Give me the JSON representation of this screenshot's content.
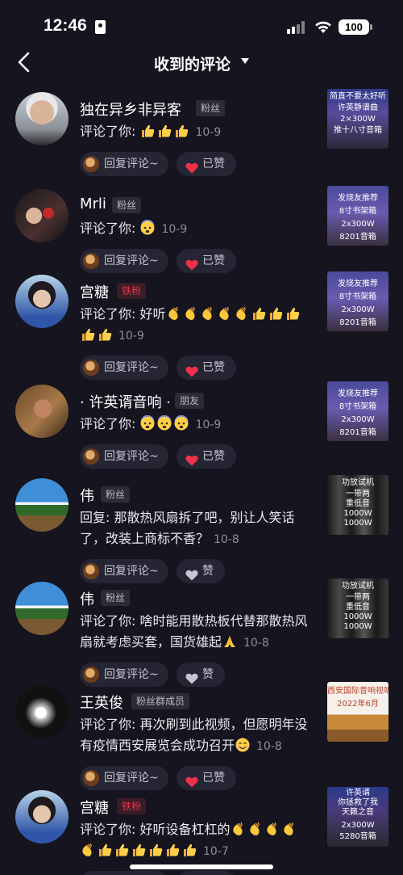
{
  "status": {
    "time": "12:46",
    "battery": "100"
  },
  "nav": {
    "title": "收到的评论"
  },
  "actions": {
    "reply_label": "回复评论~",
    "liked_label": "已赞",
    "like_label": "赞"
  },
  "colors": {
    "background": "#15141f",
    "liked_heart": "#f0314a",
    "unliked_heart": "#c7c6d0",
    "button_bg": "#262534"
  },
  "comments": [
    {
      "username": "独在异乡非异客",
      "badge": "粉丝",
      "badge_style": "normal",
      "prefix": "评论了你: ",
      "text": "",
      "emojis": [
        "thumbs-up",
        "thumbs-up",
        "thumbs-up"
      ],
      "date": "10-9",
      "liked": true,
      "thumb": {
        "lines": [
          "简直不要太好听",
          "许英静谱曲",
          "2×300W",
          "推十八寸音箱"
        ]
      }
    },
    {
      "username": "Mrli",
      "badge": "粉丝",
      "badge_style": "normal",
      "prefix": "评论了你: ",
      "text": "",
      "emojis": [
        "fearful-face"
      ],
      "date": "10-9",
      "liked": true,
      "thumb": {
        "lines": [
          "发烧友推荐",
          "8寸书架箱",
          "2x300W",
          "8201音箱"
        ]
      }
    },
    {
      "username": "宫糖",
      "badge": "铁粉",
      "badge_style": "gold",
      "prefix": "评论了你: ",
      "text": "好听",
      "emojis": [
        "clap",
        "clap",
        "clap",
        "clap",
        "clap",
        "thumbs-up",
        "thumbs-up",
        "thumbs-up",
        "thumbs-up",
        "thumbs-up"
      ],
      "date": "10-9",
      "liked": true,
      "thumb": {
        "lines": [
          "发烧友推荐",
          "8寸书架箱",
          "2x300W",
          "8201音箱"
        ]
      }
    },
    {
      "username": "· 许英谞音响 ·",
      "badge": "朋友",
      "badge_style": "normal",
      "prefix": "评论了你: ",
      "text": "",
      "emojis": [
        "fearful-face",
        "fearful-face",
        "fearful-face"
      ],
      "date": "10-9",
      "liked": true,
      "thumb": {
        "lines": [
          "发烧友推荐",
          "8寸书架箱",
          "2x300W",
          "8201音箱"
        ]
      }
    },
    {
      "username": "伟",
      "badge": "粉丝",
      "badge_style": "normal",
      "prefix": "回复: ",
      "text": "那散热风扇拆了吧，别让人笑话了，改装上商标不香？",
      "emojis": [],
      "date": "10-8",
      "liked": false,
      "thumb": {
        "lines": [
          "功放试机",
          "一带两",
          "重低音",
          "1000W",
          "1000W"
        ]
      }
    },
    {
      "username": "伟",
      "badge": "粉丝",
      "badge_style": "normal",
      "prefix": "评论了你: ",
      "text": "啥时能用散热板代替那散热风扇就考虑买套，国货雄起",
      "emojis": [
        "pray"
      ],
      "date": "10-8",
      "liked": false,
      "thumb": {
        "lines": [
          "功放试机",
          "一带两",
          "重低音",
          "1000W",
          "1000W"
        ]
      }
    },
    {
      "username": "王英俊",
      "badge": "粉丝群成员",
      "badge_style": "normal",
      "prefix": "评论了你: ",
      "text": "再次刷到此视频，但愿明年没有疫情西安展览会成功召开",
      "emojis": [
        "smile"
      ],
      "date": "10-8",
      "liked": true,
      "thumb": {
        "lines": [
          "西安国际音响视听展",
          "2022年6月"
        ]
      }
    },
    {
      "username": "宫糖",
      "badge": "铁粉",
      "badge_style": "gold",
      "prefix": "评论了你: ",
      "text": "好听设备杠杠的",
      "emojis": [
        "clap",
        "clap",
        "clap",
        "clap",
        "clap",
        "thumbs-up",
        "thumbs-up",
        "thumbs-up",
        "thumbs-up",
        "thumbs-up",
        "thumbs-up"
      ],
      "date": "10-7",
      "liked": true,
      "thumb": {
        "lines": [
          "许英谞",
          "你拯救了我",
          "天籁之音",
          "2x300W",
          "5280音箱"
        ]
      }
    }
  ]
}
